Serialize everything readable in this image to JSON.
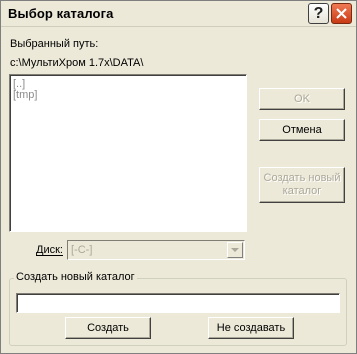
{
  "window": {
    "title": "Выбор каталога",
    "help_glyph": "?"
  },
  "selected_path": {
    "label": "Выбранный путь:",
    "value": "c:\\МультиХром 1.7x\\DATA\\"
  },
  "directory_list": {
    "items": [
      "[..]",
      "[tmp]"
    ]
  },
  "buttons": {
    "ok": "OK",
    "cancel": "Отмена",
    "create_new_line1": "Создать новый",
    "create_new_line2": "каталог"
  },
  "disk": {
    "label": "Диск:",
    "value": "[-C-]"
  },
  "create_group": {
    "legend": "Создать новый каталог",
    "input_value": "",
    "create_button": "Создать",
    "dont_create_button": "Не создавать"
  },
  "icons": {
    "help": "help-icon",
    "close": "close-icon",
    "dropdown": "chevron-down-icon"
  },
  "colors": {
    "dialog_bg": "#ece9d8",
    "close_red": "#d84a20",
    "disabled_text": "#aca899",
    "list_text": "#8c8c8c"
  }
}
